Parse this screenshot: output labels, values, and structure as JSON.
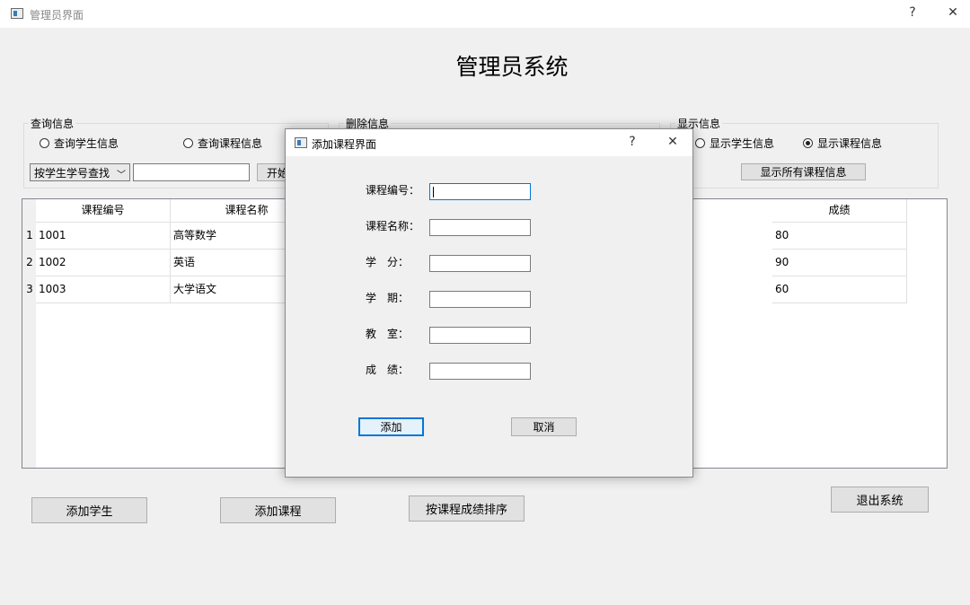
{
  "window": {
    "title": "管理员界面",
    "help": "?",
    "close": "✕"
  },
  "main_title": "管理员系统",
  "query_group": {
    "legend": "查询信息",
    "radio_student": "查询学生信息",
    "radio_course": "查询课程信息",
    "combo_value": "按学生学号查找",
    "start_button": "开始"
  },
  "delete_group": {
    "legend": "删除信息"
  },
  "display_group": {
    "legend": "显示信息",
    "radio_student": "显示学生信息",
    "radio_course": "显示课程信息",
    "show_all_button": "显示所有课程信息"
  },
  "table": {
    "headers": [
      "课程编号",
      "课程名称",
      "成绩"
    ],
    "rows": [
      {
        "num": "1",
        "id": "1001",
        "name": "高等数学",
        "score": "80"
      },
      {
        "num": "2",
        "id": "1002",
        "name": "英语",
        "score": "90"
      },
      {
        "num": "3",
        "id": "1003",
        "name": "大学语文",
        "score": "60"
      }
    ]
  },
  "bottom_buttons": {
    "add_student": "添加学生",
    "add_course": "添加课程",
    "sort_by_score": "按课程成绩排序",
    "exit": "退出系统"
  },
  "dialog": {
    "title": "添加课程界面",
    "help": "?",
    "close": "✕",
    "fields": [
      {
        "label": "课程编号：",
        "value": ""
      },
      {
        "label": "课程名称：",
        "value": ""
      },
      {
        "label": "学　分：",
        "value": ""
      },
      {
        "label": "学　期：",
        "value": ""
      },
      {
        "label": "教　室：",
        "value": ""
      },
      {
        "label": "成　绩：",
        "value": ""
      }
    ],
    "add_button": "添加",
    "cancel_button": "取消"
  }
}
